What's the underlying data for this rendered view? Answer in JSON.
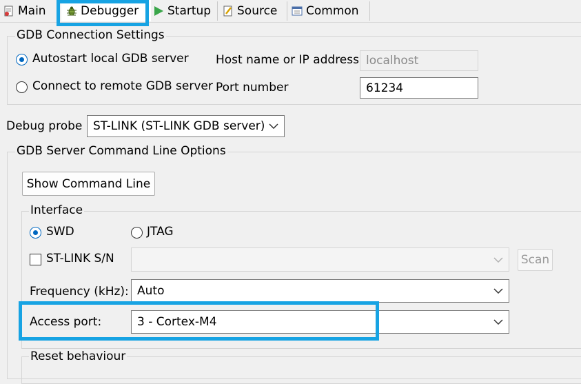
{
  "tabs": [
    {
      "label": "Main",
      "icon": "main-config-icon",
      "active": false
    },
    {
      "label": "Debugger",
      "icon": "debug-bug-icon",
      "active": true
    },
    {
      "label": "Startup",
      "icon": "play-icon",
      "active": false
    },
    {
      "label": "Source",
      "icon": "source-icon",
      "active": false
    },
    {
      "label": "Common",
      "icon": "common-icon",
      "active": false
    }
  ],
  "gdb_connection": {
    "title": "GDB Connection Settings",
    "autostart_label": "Autostart local GDB server",
    "remote_label": "Connect to remote GDB server",
    "host_label": "Host name or IP address",
    "host_value": "localhost",
    "port_label": "Port number",
    "port_value": "61234"
  },
  "debug_probe": {
    "label": "Debug probe",
    "value": "ST-LINK (ST-LINK GDB server)"
  },
  "gdb_server_options": {
    "title": "GDB Server Command Line Options",
    "show_command_line_label": "Show Command Line"
  },
  "interface": {
    "title": "Interface",
    "swd_label": "SWD",
    "jtag_label": "JTAG",
    "stlink_sn_label": "ST-LINK S/N",
    "stlink_sn_value": "",
    "scan_label": "Scan",
    "frequency_label": "Frequency (kHz):",
    "frequency_value": "Auto",
    "access_port_label": "Access port:",
    "access_port_value": "3 - Cortex-M4"
  },
  "reset": {
    "title": "Reset behaviour"
  },
  "colors": {
    "highlight": "#17a3e3",
    "radio_accent": "#0067c0"
  }
}
